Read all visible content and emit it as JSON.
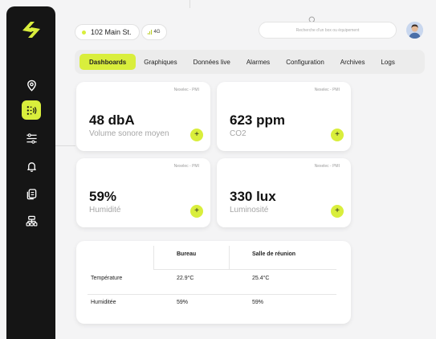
{
  "colors": {
    "accent": "#d9ee3c",
    "sidebar": "#151515"
  },
  "sidebar": {
    "items": [
      {
        "icon": "location-pin-icon",
        "active": false
      },
      {
        "icon": "sensor-list-icon",
        "active": true
      },
      {
        "icon": "sliders-icon",
        "active": false
      },
      {
        "icon": "bell-icon",
        "active": false
      },
      {
        "icon": "documents-icon",
        "active": false
      },
      {
        "icon": "sitemap-icon",
        "active": false
      }
    ]
  },
  "topbar": {
    "address": "102 Main St.",
    "network": "4G",
    "search_placeholder": "Recherche d'un box ou équipement"
  },
  "tabs": [
    "Dashboards",
    "Graphiques",
    "Données live",
    "Alarmes",
    "Configuration",
    "Archives",
    "Logs"
  ],
  "cards": [
    {
      "source": "Nexelec - PMI",
      "value": "48 dbA",
      "label": "Volume sonore moyen"
    },
    {
      "source": "Nexelec - PMI",
      "value": "623 ppm",
      "label": "CO2"
    },
    {
      "source": "Nexelec - PMI",
      "value": "59%",
      "label": "Humidité"
    },
    {
      "source": "Nexelec - PMI",
      "value": "330 lux",
      "label": "Luminosité"
    }
  ],
  "add_label": "+",
  "table": {
    "columns": [
      "Bureau",
      "Salle de réunion"
    ],
    "rows": [
      {
        "label": "Température",
        "values": [
          "22.9°C",
          "25.4°C"
        ]
      },
      {
        "label": "Humiditée",
        "values": [
          "59%",
          "59%"
        ]
      }
    ]
  }
}
